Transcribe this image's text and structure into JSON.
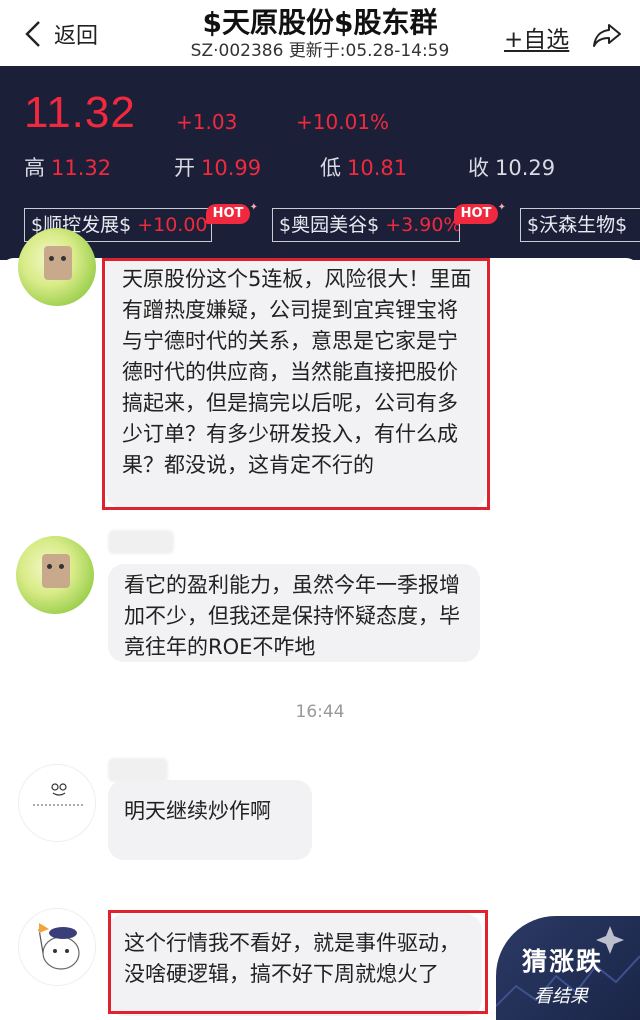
{
  "header": {
    "back_label": "返回",
    "title": "$天原股份$股东群",
    "subtitle": "SZ·002386 更新于:05.28-14:59",
    "add_fav_label": "+自选"
  },
  "quote": {
    "price": "11.32",
    "change": "+1.03",
    "change_pct": "+10.01%",
    "high_label": "高",
    "high": "11.32",
    "open_label": "开",
    "open": "10.99",
    "low_label": "低",
    "low": "10.81",
    "close_label": "收",
    "close": "10.29",
    "up_color": "#f0293e",
    "panel_color": "#1b2038"
  },
  "hot_stocks": [
    {
      "name": "$顺控发展$",
      "pct": "+10.00%",
      "hot": "HOT"
    },
    {
      "name": "$奥园美谷$",
      "pct": "+3.90%",
      "hot": "HOT"
    },
    {
      "name": "$沃森生物$",
      "pct": ""
    }
  ],
  "messages": [
    {
      "text": "天原股份这个5连板，风险很大！里面有蹭热度嫌疑，公司提到宜宾锂宝将与宁德时代的关系，意思是它家是宁德时代的供应商，当然能直接把股价搞起来，但是搞完以后呢，公司有多少订单？有多少研发投入，有什么成果？都没说，这肯定不行的"
    },
    {
      "text": "看它的盈利能力，虽然今年一季报增加不少，但我还是保持怀疑态度，毕竟往年的ROE不咋地"
    },
    {
      "text": "明天继续炒作啊"
    },
    {
      "text": "这个行情我不看好，就是事件驱动，没啥硬逻辑，搞不好下周就熄火了"
    }
  ],
  "timestamp": "16:44",
  "badge": {
    "title": "猜涨跌",
    "subtitle": "看结果"
  }
}
